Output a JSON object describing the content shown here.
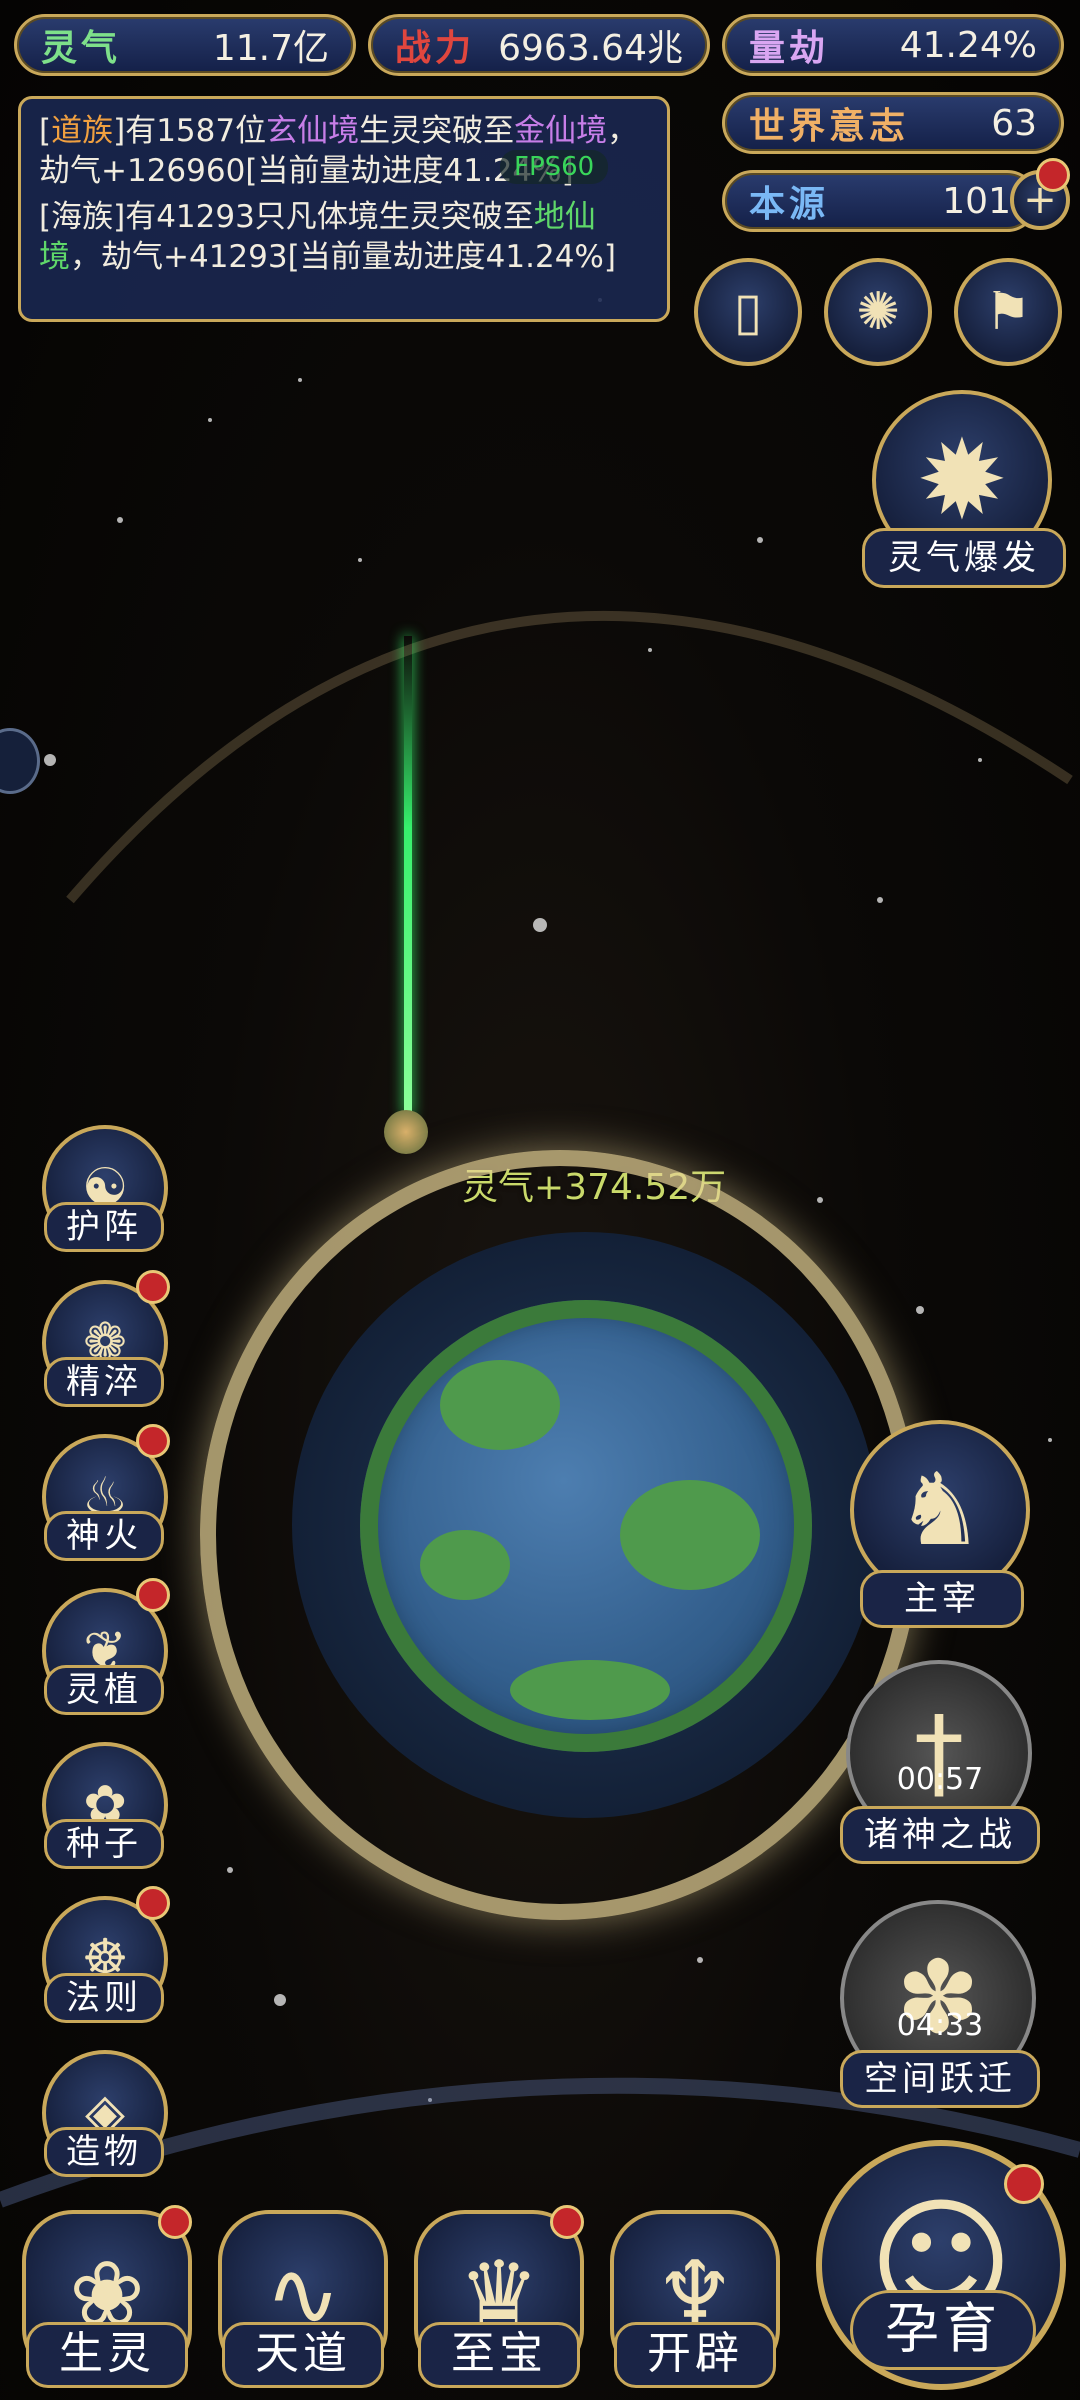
{
  "top_stats": {
    "lingqi": {
      "label": "灵气",
      "value": "11.7亿",
      "color": "#7ee08a"
    },
    "zhanli": {
      "label": "战力",
      "value": "6963.64兆",
      "color": "#e0463e"
    },
    "liangjie": {
      "label": "量劫",
      "value": "41.24%",
      "color": "#d9a6f2"
    },
    "shijie": {
      "label": "世界意志",
      "value": "63",
      "color": "#f0b066"
    },
    "benyuan": {
      "label": "本源",
      "value": "101",
      "color": "#7ab8f5"
    }
  },
  "log": {
    "line1_pre": "[",
    "line1_race": "道族",
    "line1_a": "]有1587位",
    "line1_realm1": "玄仙境",
    "line1_b": "生灵突破至",
    "line1_realm2": "金仙境",
    "line1_c": "，劫气+126960[当前量劫进度41.24%]",
    "line2_a": "[海族]有41293只凡体境生灵突破至",
    "line2_realm": "地仙境",
    "line2_b": "，劫气+41293[当前量劫进度41.24%]"
  },
  "fps": "FPS60",
  "top_actions": [
    "cards-icon",
    "vortex-icon",
    "flag-icon"
  ],
  "burst": {
    "label": "灵气爆发"
  },
  "float_text": "灵气+374.52万",
  "left_menu": [
    {
      "label": "护阵",
      "icon": "yin-yang-icon",
      "badge": false
    },
    {
      "label": "精淬",
      "icon": "lotus-flame-icon",
      "badge": true
    },
    {
      "label": "神火",
      "icon": "flame-icon",
      "badge": true
    },
    {
      "label": "灵植",
      "icon": "plant-icon",
      "badge": true
    },
    {
      "label": "种子",
      "icon": "seed-flower-icon",
      "badge": false
    },
    {
      "label": "法则",
      "icon": "rules-icon",
      "badge": true
    },
    {
      "label": "造物",
      "icon": "creation-icon",
      "badge": false
    }
  ],
  "right_menu": [
    {
      "label": "主宰",
      "icon": "dragon-icon",
      "timer": ""
    },
    {
      "label": "诸神之战",
      "icon": "sword-icon",
      "timer": "00:57"
    },
    {
      "label": "空间跃迁",
      "icon": "portal-icon",
      "timer": "04:33"
    }
  ],
  "bottom_menu": [
    {
      "label": "生灵",
      "badge": true
    },
    {
      "label": "天道",
      "badge": false
    },
    {
      "label": "至宝",
      "badge": true
    },
    {
      "label": "开辟",
      "badge": false
    }
  ],
  "yunyu": {
    "label": "孕育",
    "badge": true
  },
  "colors": {
    "gold": "#c9a85a",
    "panel": "#1a2852",
    "badge": "#c4262a"
  }
}
